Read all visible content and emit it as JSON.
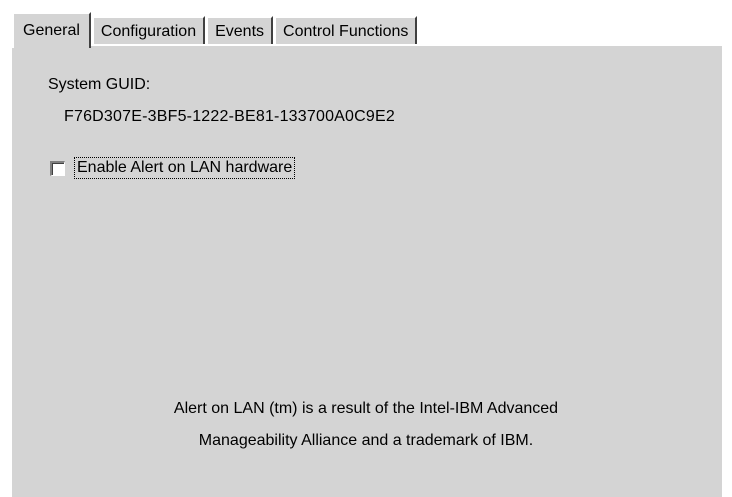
{
  "tabs": [
    {
      "label": "General",
      "active": true
    },
    {
      "label": "Configuration",
      "active": false
    },
    {
      "label": "Events",
      "active": false
    },
    {
      "label": "Control Functions",
      "active": false
    }
  ],
  "general": {
    "guid_label": "System GUID:",
    "guid_value": "F76D307E-3BF5-1222-BE81-133700A0C9E2",
    "alert_checkbox": {
      "label": "Enable Alert on LAN hardware",
      "checked": false
    },
    "footer_line1": "Alert on LAN (tm) is a result of the Intel-IBM Advanced",
    "footer_line2": "Manageability Alliance and a trademark of IBM."
  },
  "colors": {
    "panel_bg": "#d4d4d4",
    "highlight": "#ffffff",
    "shadow": "#404040"
  }
}
